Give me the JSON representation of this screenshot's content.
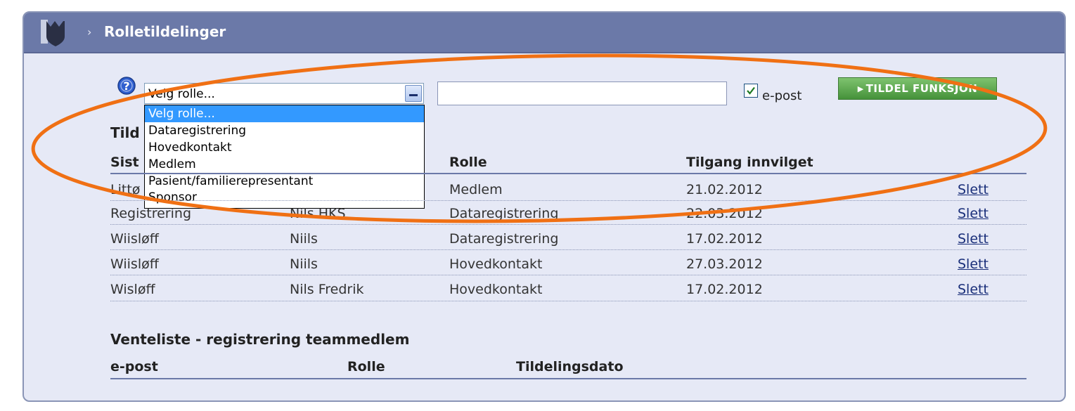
{
  "header": {
    "title": "Rolletildelinger",
    "icon": "shield-icon",
    "breadcrumb_arrow": "›"
  },
  "form": {
    "help_icon": "help-icon",
    "role_select": {
      "selected": "Velg rolle...",
      "options": [
        "Velg rolle...",
        "Dataregistrering",
        "Hovedkontakt",
        "Medlem",
        "Pasient/familierepresentant",
        "Sponsor"
      ]
    },
    "text_input": {
      "value": "",
      "placeholder": ""
    },
    "email_checkbox": {
      "checked": true,
      "label": "e-post"
    },
    "assign_button": {
      "label": "TILDEL FUNKSJON"
    }
  },
  "assignments": {
    "heading_visible": "Tild",
    "columns": {
      "last_name": "Sist",
      "role": "Rolle",
      "granted": "Tilgang innvilget"
    },
    "rows": [
      {
        "last_name": "Littø",
        "first_name": "",
        "role": "Medlem",
        "granted": "21.02.2012",
        "action": "Slett"
      },
      {
        "last_name": "Registrering",
        "first_name": "Nils HKS",
        "role": "Dataregistrering",
        "granted": "22.03.2012",
        "action": "Slett"
      },
      {
        "last_name": "Wiisløff",
        "first_name": "Niils",
        "role": "Dataregistrering",
        "granted": "17.02.2012",
        "action": "Slett"
      },
      {
        "last_name": "Wiisløff",
        "first_name": "Niils",
        "role": "Hovedkontakt",
        "granted": "27.03.2012",
        "action": "Slett"
      },
      {
        "last_name": "Wisløff",
        "first_name": "Nils Fredrik",
        "role": "Hovedkontakt",
        "granted": "17.02.2012",
        "action": "Slett"
      }
    ]
  },
  "waitlist": {
    "heading": "Venteliste - registrering teammedlem",
    "columns": {
      "email": "e-post",
      "role": "Rolle",
      "date": "Tildelingsdato"
    }
  },
  "annotation": {
    "color": "#f07014"
  },
  "colors": {
    "header": "#6b79a8",
    "panel": "#e6e9f6",
    "button": "#56a34a",
    "selected_option": "#3399ff"
  }
}
